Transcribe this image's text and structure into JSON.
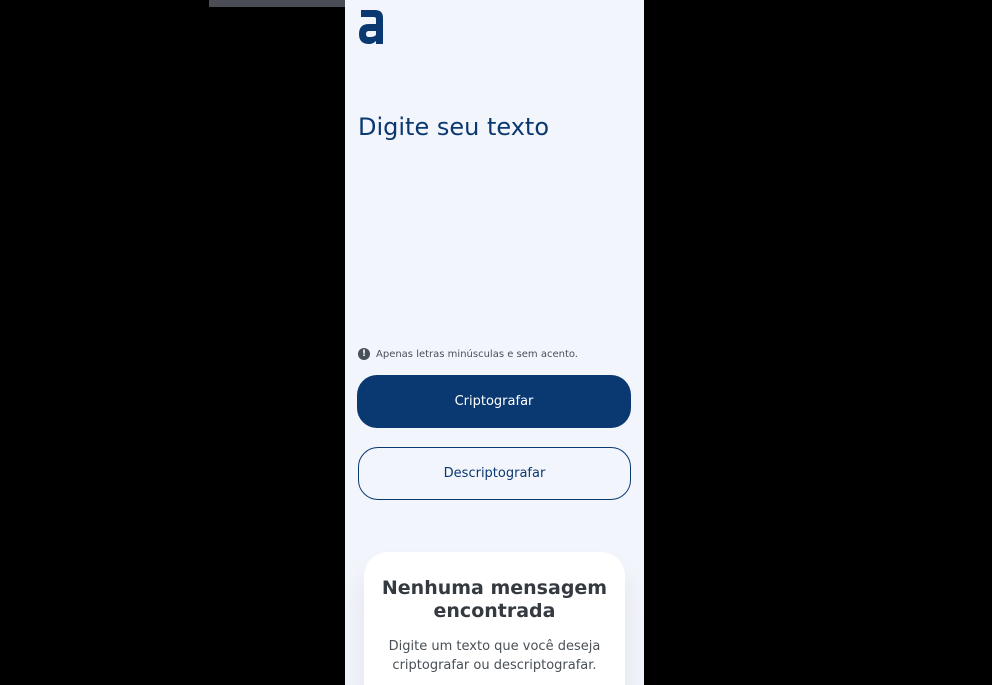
{
  "logo": {
    "name": "alura-logo"
  },
  "input": {
    "heading": "Digite seu texto",
    "value": ""
  },
  "hint": {
    "icon": "info-icon",
    "text": "Apenas letras minúsculas e sem acento."
  },
  "actions": {
    "encrypt_label": "Criptografar",
    "decrypt_label": "Descriptografar"
  },
  "result": {
    "title_line1": "Nenhuma mensagem",
    "title_line2": "encontrada",
    "desc_line1": "Digite um texto que você deseja",
    "desc_line2": "criptografar ou descriptografar."
  },
  "colors": {
    "background": "#000000",
    "page": "#f3f5fc",
    "primary": "#0a3871",
    "card": "#ffffff",
    "text_dark": "#343a40",
    "text_muted": "#495057",
    "topbar": "#4a4d55"
  }
}
